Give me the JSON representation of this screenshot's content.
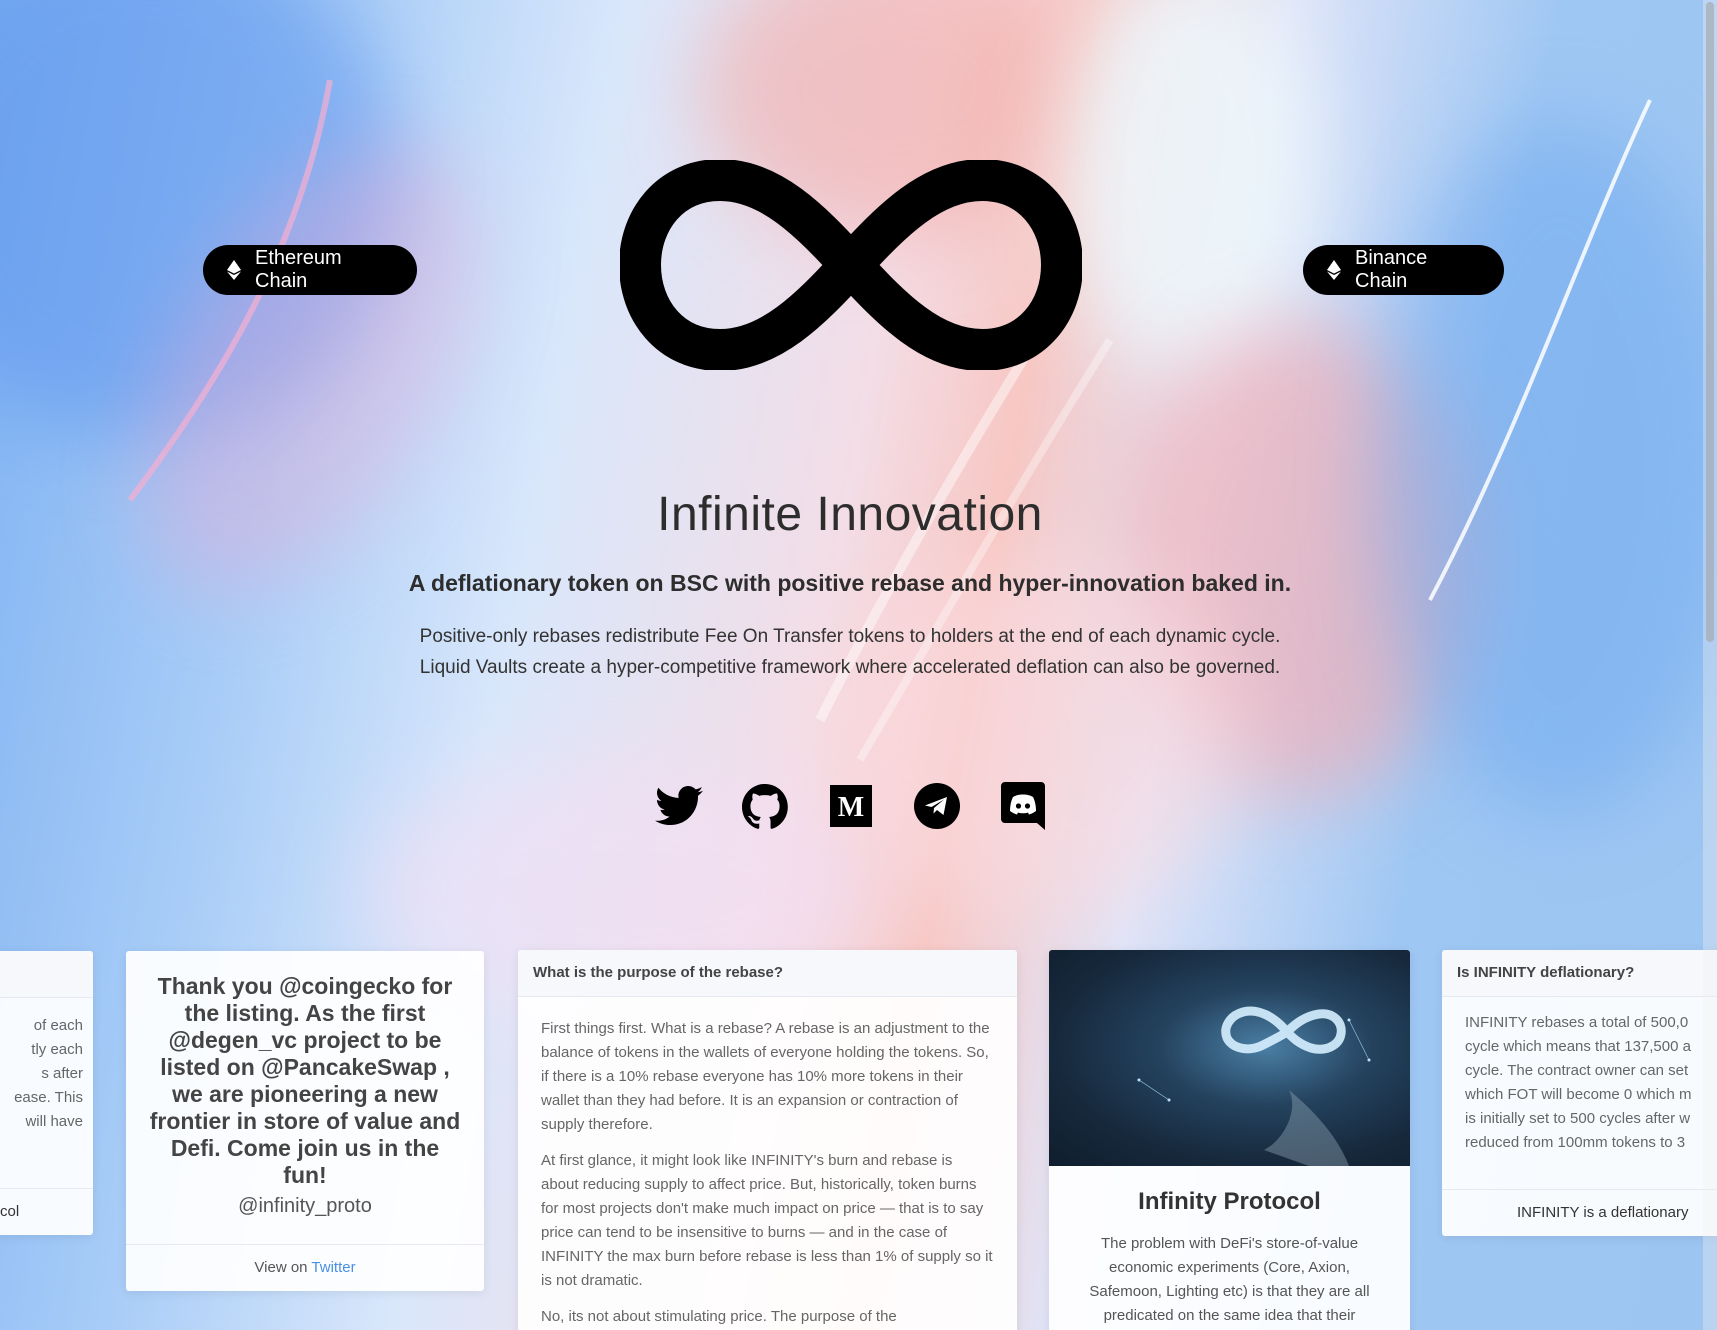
{
  "header": {
    "ethereum_label": "Ethereum Chain",
    "binance_label": "Binance Chain"
  },
  "hero": {
    "title": "Infinite Innovation",
    "subtitle": "A deflationary token on BSC with positive rebase and hyper-innovation baked in.",
    "description_line1": "Positive-only rebases redistribute Fee On Transfer tokens to holders at the end of each dynamic cycle.",
    "description_line2": "Liquid Vaults create a hyper-competitive framework where accelerated deflation can also be governed."
  },
  "socials": [
    "twitter-icon",
    "github-icon",
    "medium-icon",
    "telegram-icon",
    "discord-icon"
  ],
  "cards": {
    "left_fragment": {
      "lines": [
        "of each",
        "tly each",
        "s after",
        "ease. This",
        "will have"
      ],
      "footer": "col"
    },
    "tweet": {
      "text": "Thank you @coingecko for the listing. As the first @degen_vc project to be listed on @PancakeSwap , we are pioneering a new frontier in store of value and Defi. Come join us in the fun!",
      "handle": "@infinity_proto",
      "footer_prefix": "View on",
      "footer_link": "Twitter"
    },
    "rebase": {
      "header": "What is the purpose of the rebase?",
      "p1": "First things first. What is a rebase? A rebase is an adjustment to the balance of tokens in the wallets of everyone holding the tokens. So, if there is a 10% rebase everyone has 10% more tokens in their wallet than they had before. It is an expansion or contraction of supply therefore.",
      "p2": "At first glance, it might look like INFINITY's burn and rebase is about reducing supply to affect price. But, historically, token burns for most projects don't make much impact on price — that is to say price can tend to be insensitive to burns — and in the case of INFINITY the max burn before rebase is less than 1% of supply so it is not dramatic.",
      "p3": "No, its not about stimulating price. The purpose of the"
    },
    "protocol": {
      "title": "Infinity Protocol",
      "text": "The problem with DeFi's store-of-value economic experiments (Core, Axion, Safemoon, Lighting etc) is that they are all predicated on the same idea that their"
    },
    "deflationary": {
      "header": "Is INFINITY deflationary?",
      "lines": [
        "INFINITY rebases a total of 500,0",
        "cycle which means that 137,500 a",
        "cycle. The contract owner can set",
        "which FOT will become 0 which m",
        "is initially set to 500 cycles after w",
        "reduced from 100mm tokens to 3"
      ],
      "footer": "INFINITY is a deflationary"
    }
  },
  "colors": {
    "button_bg": "#000000",
    "link": "#4a90e2",
    "text": "#2d2d2d"
  }
}
